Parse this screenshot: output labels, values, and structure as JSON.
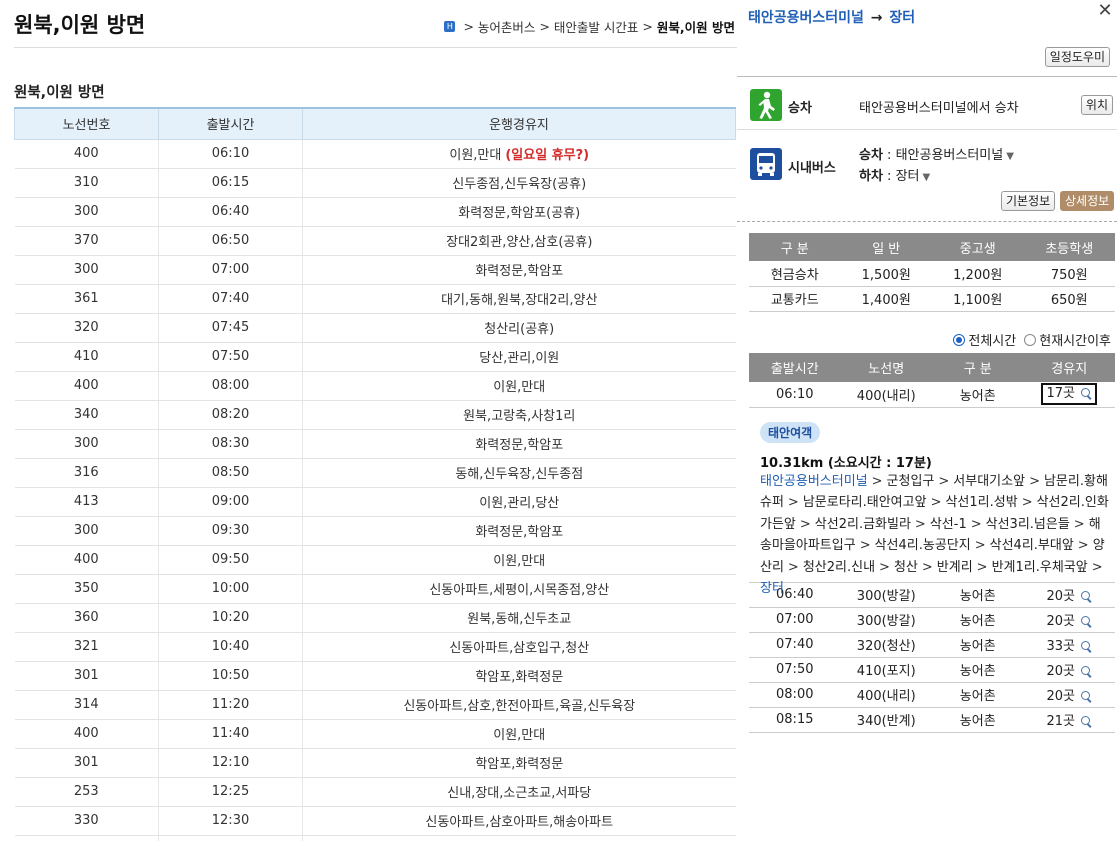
{
  "page": {
    "title": "원북,이원 방면",
    "breadcrumb": [
      "농어촌버스",
      "태안출발 시간표",
      "원북,이원 방면"
    ],
    "section_title": "원북,이원 방면",
    "table_headers": [
      "노선번호",
      "출발시간",
      "운행경유지"
    ],
    "rows": [
      {
        "route": "400",
        "time": "06:10",
        "via": "이원,만대",
        "note": "(일요일 휴무?)"
      },
      {
        "route": "310",
        "time": "06:15",
        "via": "신두종점,신두육장(공휴)"
      },
      {
        "route": "300",
        "time": "06:40",
        "via": "화력정문,학암포(공휴)"
      },
      {
        "route": "370",
        "time": "06:50",
        "via": "장대2회관,양산,삼호(공휴)"
      },
      {
        "route": "300",
        "time": "07:00",
        "via": "화력정문,학암포"
      },
      {
        "route": "361",
        "time": "07:40",
        "via": "대기,동해,원북,장대2리,양산"
      },
      {
        "route": "320",
        "time": "07:45",
        "via": "청산리(공휴)"
      },
      {
        "route": "410",
        "time": "07:50",
        "via": "당산,관리,이원"
      },
      {
        "route": "400",
        "time": "08:00",
        "via": "이원,만대"
      },
      {
        "route": "340",
        "time": "08:20",
        "via": "원북,고랑축,사창1리"
      },
      {
        "route": "300",
        "time": "08:30",
        "via": "화력정문,학암포"
      },
      {
        "route": "316",
        "time": "08:50",
        "via": "동해,신두육장,신두종점"
      },
      {
        "route": "413",
        "time": "09:00",
        "via": "이원,관리,당산"
      },
      {
        "route": "300",
        "time": "09:30",
        "via": "화력정문,학암포"
      },
      {
        "route": "400",
        "time": "09:50",
        "via": "이원,만대"
      },
      {
        "route": "350",
        "time": "10:00",
        "via": "신동아파트,세평이,시목종점,양산"
      },
      {
        "route": "360",
        "time": "10:20",
        "via": "원북,동해,신두초교"
      },
      {
        "route": "321",
        "time": "10:40",
        "via": "신동아파트,삼호입구,청산"
      },
      {
        "route": "301",
        "time": "10:50",
        "via": "학암포,화력정문"
      },
      {
        "route": "314",
        "time": "11:20",
        "via": "신동아파트,삼호,한전아파트,육골,신두육장"
      },
      {
        "route": "400",
        "time": "11:40",
        "via": "이원,만대"
      },
      {
        "route": "301",
        "time": "12:10",
        "via": "학암포,화력정문"
      },
      {
        "route": "253",
        "time": "12:25",
        "via": "신내,장대,소근초교,서파당"
      },
      {
        "route": "330",
        "time": "12:30",
        "via": "신동아파트,삼호아파트,해송아파트"
      },
      {
        "route": "",
        "time": "",
        "via": ""
      }
    ]
  },
  "popup": {
    "from": "태안공용버스터미널",
    "arrow": "→",
    "to": "장터",
    "help_button": "일정도우미",
    "boarding_label": "승차",
    "boarding_text": "태안공용버스터미널에서 승차",
    "location_button": "위치",
    "city_bus_label": "시내버스",
    "board_key": "승차",
    "board_stop": "태안공용버스터미널",
    "alight_key": "하차",
    "alight_stop": "장터",
    "basic_button": "기본정보",
    "detail_button": "상세정보",
    "fare_headers": [
      "구 분",
      "일 반",
      "중고생",
      "초등학생"
    ],
    "fares": [
      [
        "현금승차",
        "1,500원",
        "1,200원",
        "750원"
      ],
      [
        "교통카드",
        "1,400원",
        "1,100원",
        "650원"
      ]
    ],
    "radio_all": "전체시간",
    "radio_now": "현재시간이후",
    "time_headers": [
      "출발시간",
      "노선명",
      "구 분",
      "경유지"
    ],
    "first_trip": {
      "time": "06:10",
      "route": "400(내리)",
      "type": "농어촌",
      "stops": "17곳"
    },
    "stop_badge": "태안여객",
    "distance": "10.31km (소요시간 : 17분)",
    "path_start": "태안공용버스터미널",
    "path_mid": [
      "군청입구",
      "서부대기소앞",
      "남문리.황해슈퍼",
      "남문로타리.태안여고앞",
      "삭선1리.성밖",
      "삭선2리.인화가든앞",
      "삭선2리.금화빌라",
      "삭선-1",
      "삭선3리.넘은들",
      "해송마을아파트입구",
      "삭선4리.농공단지",
      "삭선4리.부대앞",
      "양산리",
      "청산2리.신내",
      "청산",
      "반계리",
      "반계1리.우체국앞"
    ],
    "path_end": "장터",
    "trips": [
      {
        "time": "06:40",
        "route": "300(방갈)",
        "type": "농어촌",
        "stops": "20곳"
      },
      {
        "time": "07:00",
        "route": "300(방갈)",
        "type": "농어촌",
        "stops": "20곳"
      },
      {
        "time": "07:40",
        "route": "320(청산)",
        "type": "농어촌",
        "stops": "33곳"
      },
      {
        "time": "07:50",
        "route": "410(포지)",
        "type": "농어촌",
        "stops": "20곳"
      },
      {
        "time": "08:00",
        "route": "400(내리)",
        "type": "농어촌",
        "stops": "20곳"
      },
      {
        "time": "08:15",
        "route": "340(반계)",
        "type": "농어촌",
        "stops": "21곳"
      }
    ]
  }
}
